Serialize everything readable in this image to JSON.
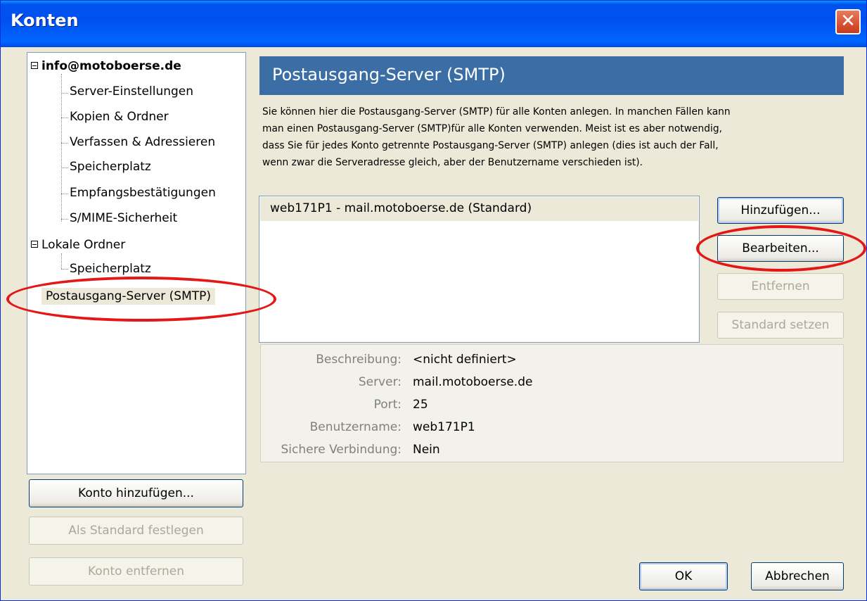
{
  "window": {
    "title": "Konten",
    "close_symbol": "✕"
  },
  "tree": {
    "account": "info@motoboerse.de",
    "account_children": [
      "Server-Einstellungen",
      "Kopien & Ordner",
      "Verfassen & Adressieren",
      "Speicherplatz",
      "Empfangsbestätigungen",
      "S/MIME-Sicherheit"
    ],
    "local": "Lokale Ordner",
    "local_children": [
      "Speicherplatz"
    ],
    "smtp": "Postausgang-Server (SMTP)"
  },
  "left_buttons": {
    "add_account": "Konto hinzufügen...",
    "set_default": "Als Standard festlegen",
    "remove_account": "Konto entfernen"
  },
  "panel": {
    "header": "Postausgang-Server (SMTP)",
    "description": [
      "Sie können hier die Postausgang-Server (SMTP) für alle Konten anlegen. In manchen Fällen kann",
      "man einen Postausgang-Server (SMTP)für alle Konten verwenden. Meist ist es aber notwendig,",
      "dass Sie für jedes Konto getrennte Postausgang-Server (SMTP) anlegen (dies ist auch der Fall,",
      "wenn zwar die Serveradresse gleich, aber der Benutzername verschieden ist)."
    ],
    "servers": [
      "web171P1 - mail.motoboerse.de (Standard)"
    ],
    "buttons": {
      "add": "Hinzufügen...",
      "edit": "Bearbeiten...",
      "remove": "Entfernen",
      "set_default": "Standard setzen"
    },
    "details": {
      "description_label": "Beschreibung:",
      "description_value": "<nicht definiert>",
      "server_label": "Server:",
      "server_value": "mail.motoboerse.de",
      "port_label": "Port:",
      "port_value": "25",
      "username_label": "Benutzername:",
      "username_value": "web171P1",
      "secure_label": "Sichere Verbindung:",
      "secure_value": "Nein"
    }
  },
  "footer": {
    "ok": "OK",
    "cancel": "Abbrechen"
  },
  "colors": {
    "titlebar": "#0053ee",
    "header": "#3a6ea5",
    "highlight": "#e51616"
  }
}
